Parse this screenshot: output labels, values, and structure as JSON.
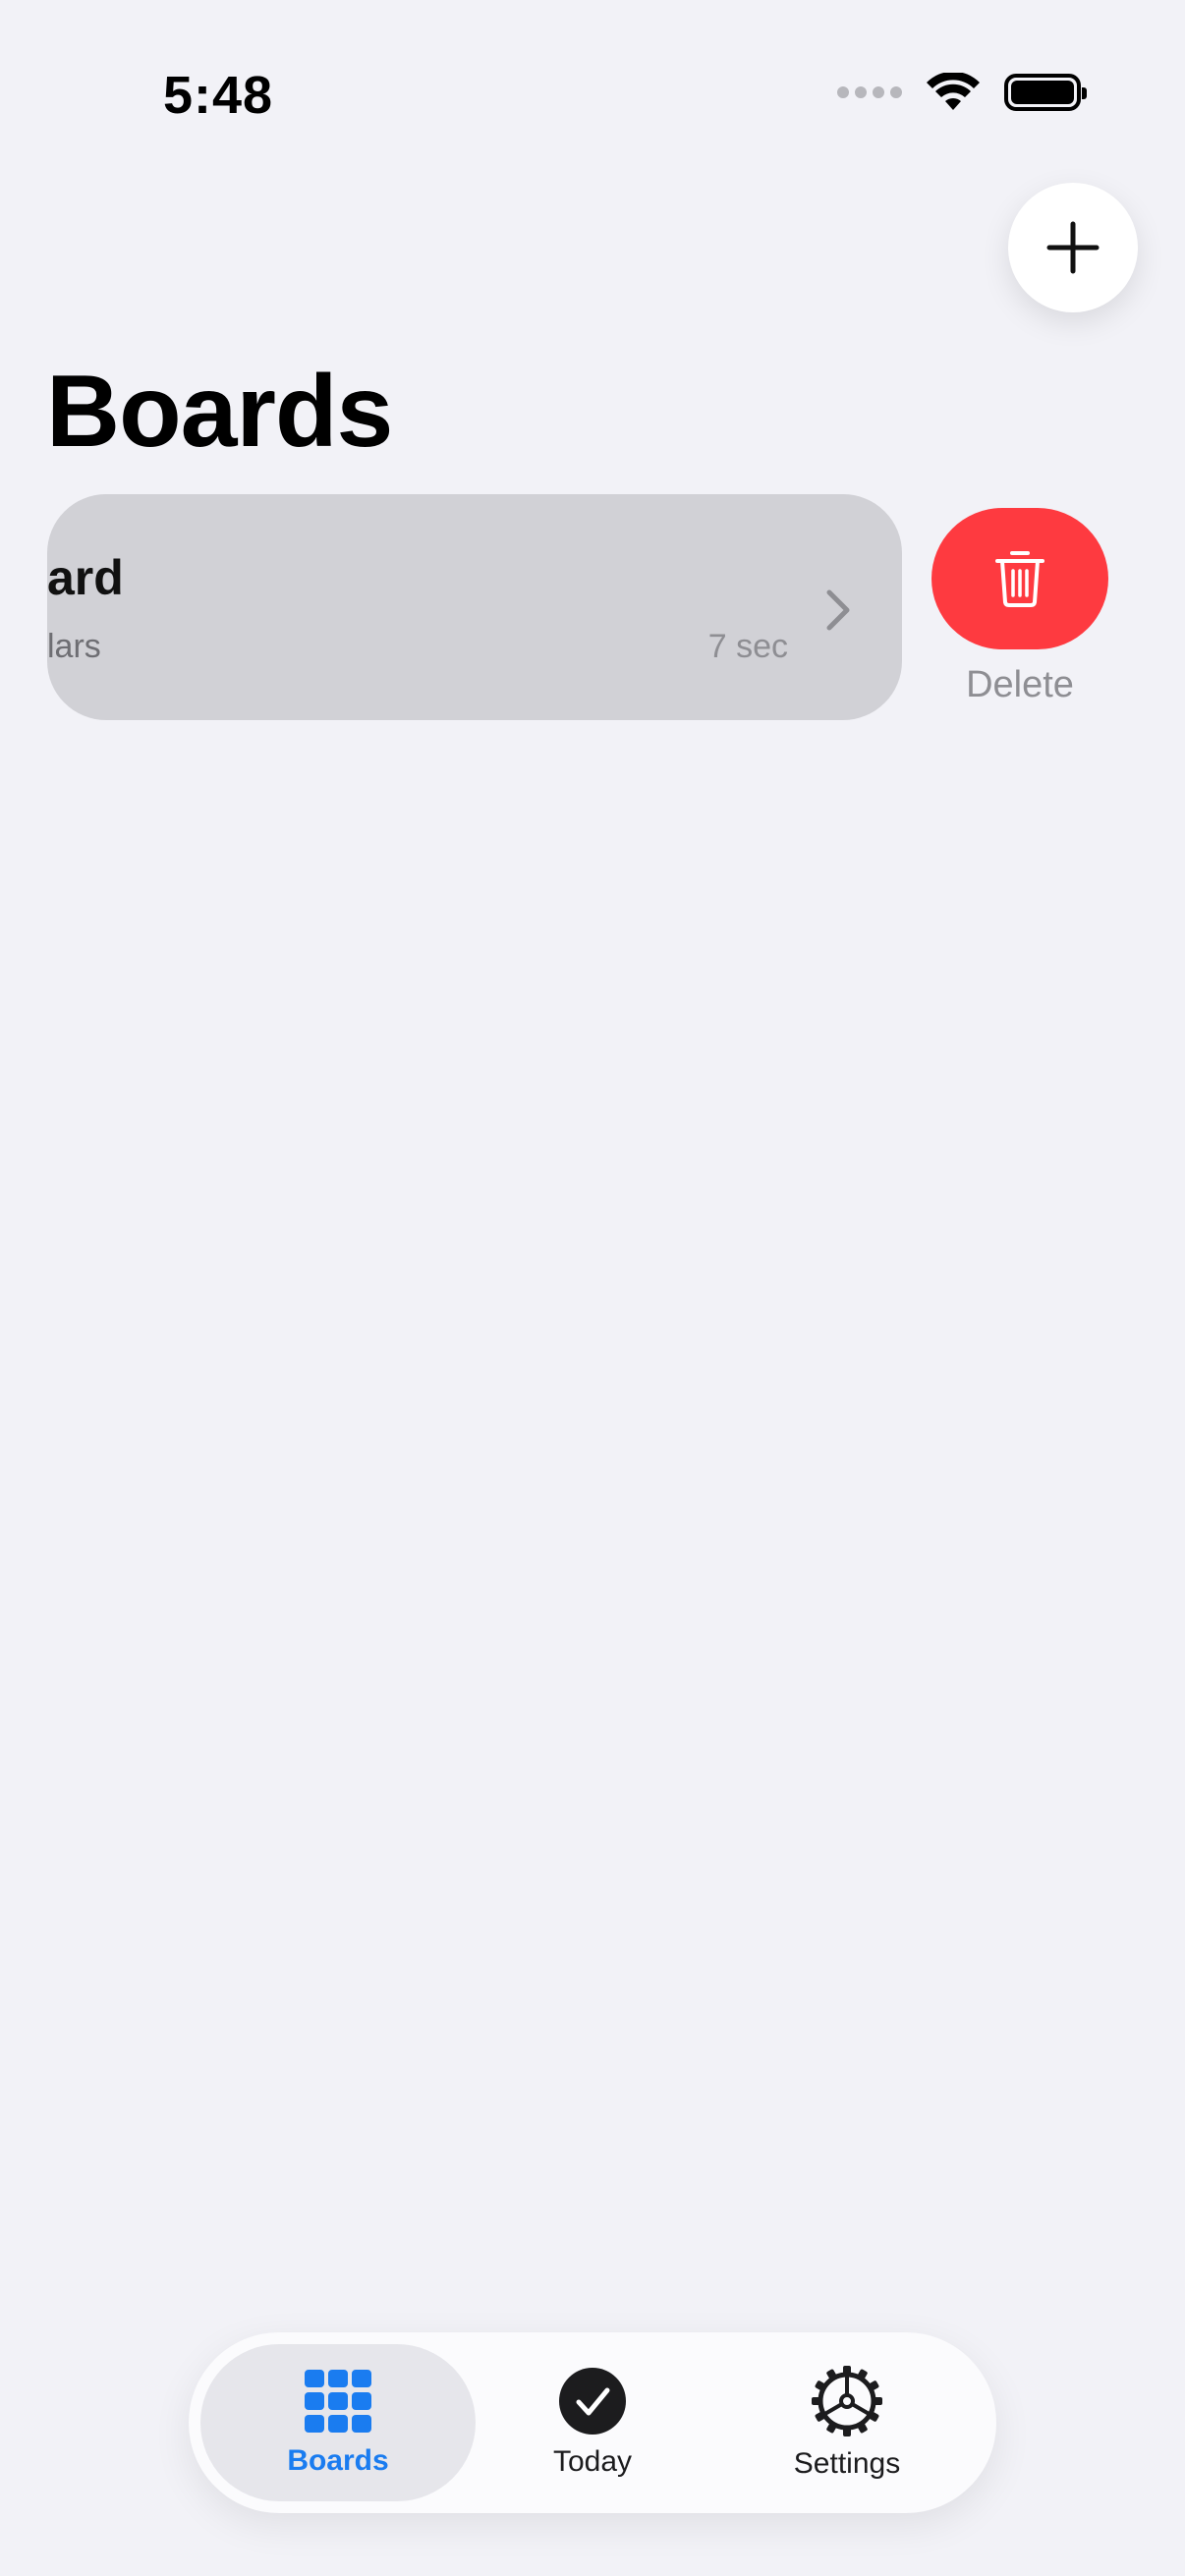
{
  "status_bar": {
    "time": "5:48"
  },
  "header": {
    "title": "Boards"
  },
  "board": {
    "name_fragment": "ard",
    "subtitle_fragment": "lars",
    "time": "7 sec"
  },
  "actions": {
    "delete_label": "Delete"
  },
  "tab_bar": {
    "tabs": [
      {
        "label": "Boards",
        "icon": "grid-icon",
        "active": true
      },
      {
        "label": "Today",
        "icon": "checkmark-circle-icon",
        "active": false
      },
      {
        "label": "Settings",
        "icon": "gear-icon",
        "active": false
      }
    ]
  },
  "colors": {
    "background": "#f2f2f7",
    "accent": "#1a7cf0",
    "destructive": "#fe3a40",
    "card_pressed": "#d1d1d6"
  }
}
